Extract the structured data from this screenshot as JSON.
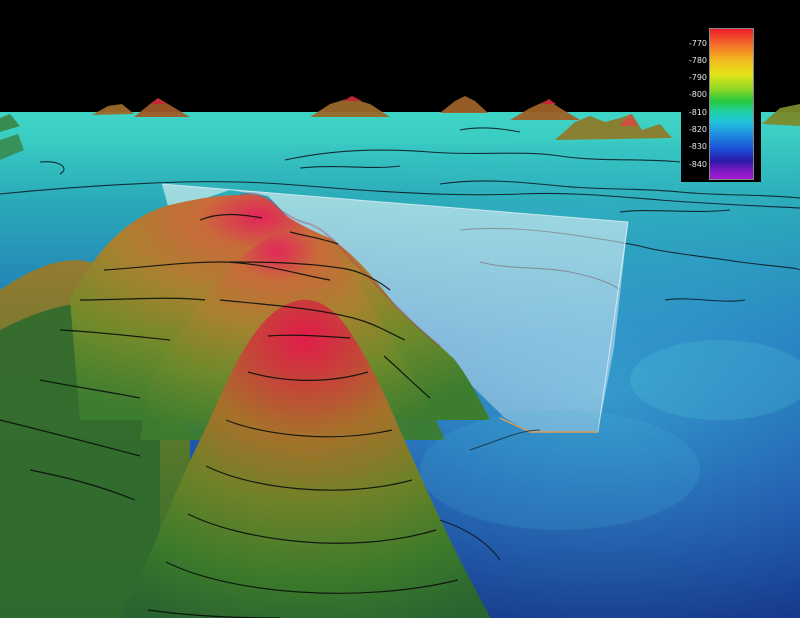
{
  "legend": {
    "ticks": [
      "-770",
      "-780",
      "-790",
      "-800",
      "-810",
      "-820",
      "-830",
      "-840"
    ],
    "colors": [
      "#ee1c2c",
      "#f2b51f",
      "#8fd726",
      "#27c93c",
      "#22c4dd",
      "#1c4fd6",
      "#2a1aa8",
      "#a51ad2"
    ]
  }
}
